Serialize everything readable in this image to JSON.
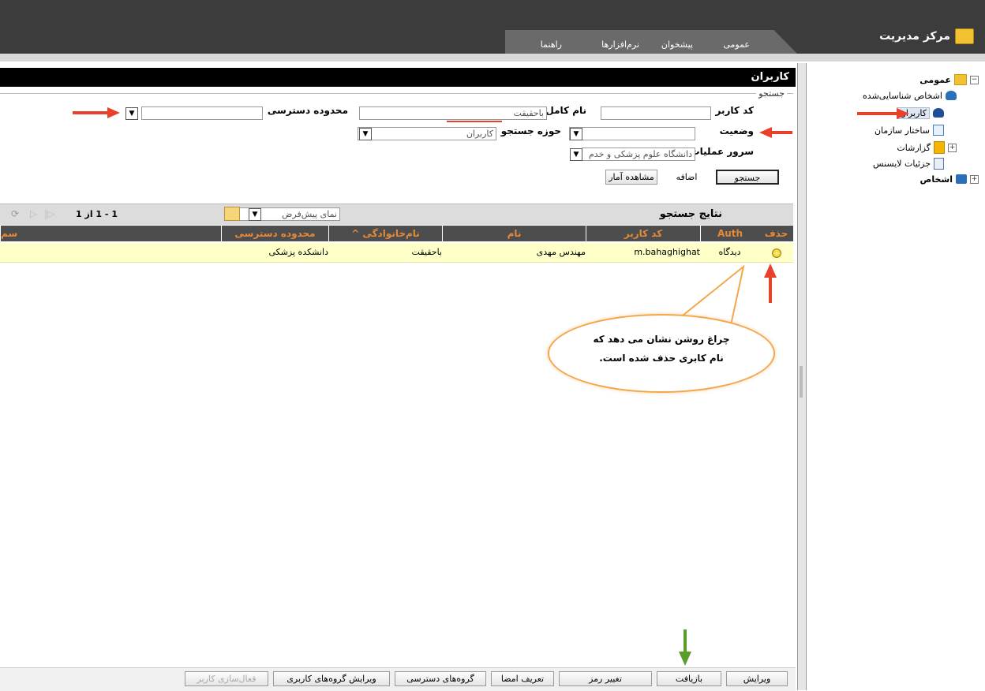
{
  "header": {
    "title": "مرکز مدیریت",
    "tabs": [
      {
        "label": "عمومی"
      },
      {
        "label": "پیشخوان"
      },
      {
        "label": "نرم‌افزارها"
      },
      {
        "label": "راهنما"
      }
    ]
  },
  "sidebar": {
    "items": [
      {
        "label": "عمومی",
        "icon": "folder-gear-icon"
      },
      {
        "label": "اشخاص شناسایی‌شده",
        "icon": "people-search-icon"
      },
      {
        "label": "کاربران",
        "icon": "users-icon"
      },
      {
        "label": "ساختار سازمان",
        "icon": "org-chart-icon"
      },
      {
        "label": "گزارشات",
        "icon": "report-icon"
      },
      {
        "label": "جزئیات لایسنس",
        "icon": "license-icon"
      },
      {
        "label": "اشخاص",
        "icon": "persons-icon"
      }
    ]
  },
  "main": {
    "title": "کاربران",
    "search": {
      "legend": "جستجو",
      "user_code_label": "کد کاربر",
      "user_code_value": "",
      "full_name_label": "نام کامل",
      "full_name_value": "باحقیقت",
      "access_scope_label": "محدوده دسترسی",
      "access_scope_value": "",
      "status_label": "وضعیت",
      "status_value": "",
      "search_domain_label": "حوزه جستجو",
      "search_domain_value": "کاربران",
      "operation_server_label": "سرور عملیات",
      "operation_server_value": "دانشگاه علوم پزشکی و خدم",
      "search_button": "جستجو",
      "add_button": "اضافه",
      "stats_button": "مشاهده آمار"
    },
    "results": {
      "title": "نتایج جستجو",
      "view_select": "نمای پیش‌فرض",
      "paging": "1 - 1 از 1",
      "columns": [
        "حذف",
        "Auth",
        "کد کاربر",
        "نام",
        "^ نام‌خانوادگی",
        "محدوده دسترسی",
        "سم"
      ],
      "rows": [
        {
          "auth": "دیدگاه",
          "user_code": "m.bahaghighat",
          "name": "مهندس مهدی",
          "last_name": "باحقیقت",
          "access_scope": "دانشکده پزشکی"
        }
      ]
    },
    "bottom_buttons": [
      "ویرایش",
      "بازیافت",
      "تغییر رمز",
      "تعریف امضا",
      "گروه‌های دسترسی",
      "ویرایش گروه‌های کاربری",
      "فعال‌سازی کاربر"
    ]
  },
  "annotation": {
    "callout_line1": "چراغ روشن نشان می دهد که",
    "callout_line2": "نام کابری حذف شده است."
  },
  "colors": {
    "header_bg": "#3c3c3c",
    "grid_header_text": "#e58a3a",
    "selected_row": "#ffffc8",
    "annotation_arrow_red": "#e8402a",
    "annotation_arrow_green": "#5a9e2a",
    "callout_border": "#f4a64a"
  }
}
